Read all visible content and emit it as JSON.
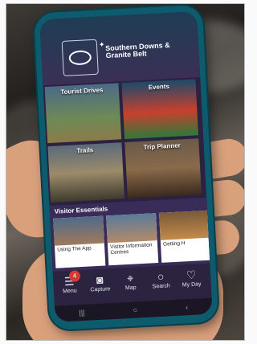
{
  "app": {
    "brand": "Southern Downs & Granite Belt",
    "logo_small": "Southern Downs"
  },
  "tiles": [
    {
      "label": "Tourist Drives"
    },
    {
      "label": "Events"
    },
    {
      "label": "Trails"
    },
    {
      "label": "Trip Planner"
    }
  ],
  "essentials": {
    "title": "Visitor Essentials",
    "cards": [
      {
        "label": "Using The App"
      },
      {
        "label": "Visitor Information Centres"
      },
      {
        "label": "Getting H"
      }
    ]
  },
  "nav": {
    "items": [
      {
        "label": "Menu",
        "icon": "menu-icon"
      },
      {
        "label": "Capture",
        "icon": "camera-icon"
      },
      {
        "label": "Map",
        "icon": "map-pin-icon"
      },
      {
        "label": "Search",
        "icon": "search-icon"
      },
      {
        "label": "My Day",
        "icon": "heart-icon"
      }
    ],
    "badge": "4"
  },
  "colors": {
    "phone_frame": "#0f5b6e",
    "screen_bg": "#2c2141",
    "nav_bg": "#2b2340",
    "badge": "#d23a32"
  }
}
